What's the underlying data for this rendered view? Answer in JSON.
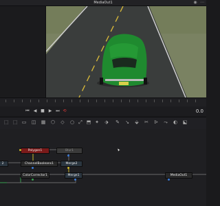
{
  "viewer": {
    "title": "MediaOut1"
  },
  "window": {
    "btn1": "◉",
    "btn2": "⋯"
  },
  "transport": {
    "first_frame_icon": "⏮",
    "prev_frame_icon": "◀",
    "stop_icon": "■",
    "play_icon": "▶",
    "last_frame_icon": "⏭",
    "loop_icon": "⟲",
    "frame_counter": "0.0"
  },
  "toolbar": {
    "icons": [
      "⬚",
      "⬚",
      "▭",
      "◫",
      "▦",
      "⬡",
      "◇",
      "○",
      "⤢",
      "⬒",
      "✦",
      "⬗",
      "✎",
      "↘",
      "⬙",
      "✂",
      "ᐅ",
      "⤳",
      "◐",
      "⬕"
    ]
  },
  "nodes": {
    "polygon": "Polygon1",
    "blur": "Blur1",
    "channel_booleans": "ChannelBooleans1",
    "merge2": "Merge2",
    "merge_left": "2",
    "color_corrector": "ColorCorrector1",
    "merge1": "Merge1",
    "media_out": "MediaOut1"
  },
  "colors": {
    "car": "#1f8a2f",
    "road": "#3b3e3c",
    "grass": "#7b8360",
    "node_polygon": "#7a1a1a",
    "node_tool": "#2a2a2a",
    "node_merge": "#2b3640",
    "link_yellow": "#c9b52a",
    "link_green": "#3aa050"
  }
}
